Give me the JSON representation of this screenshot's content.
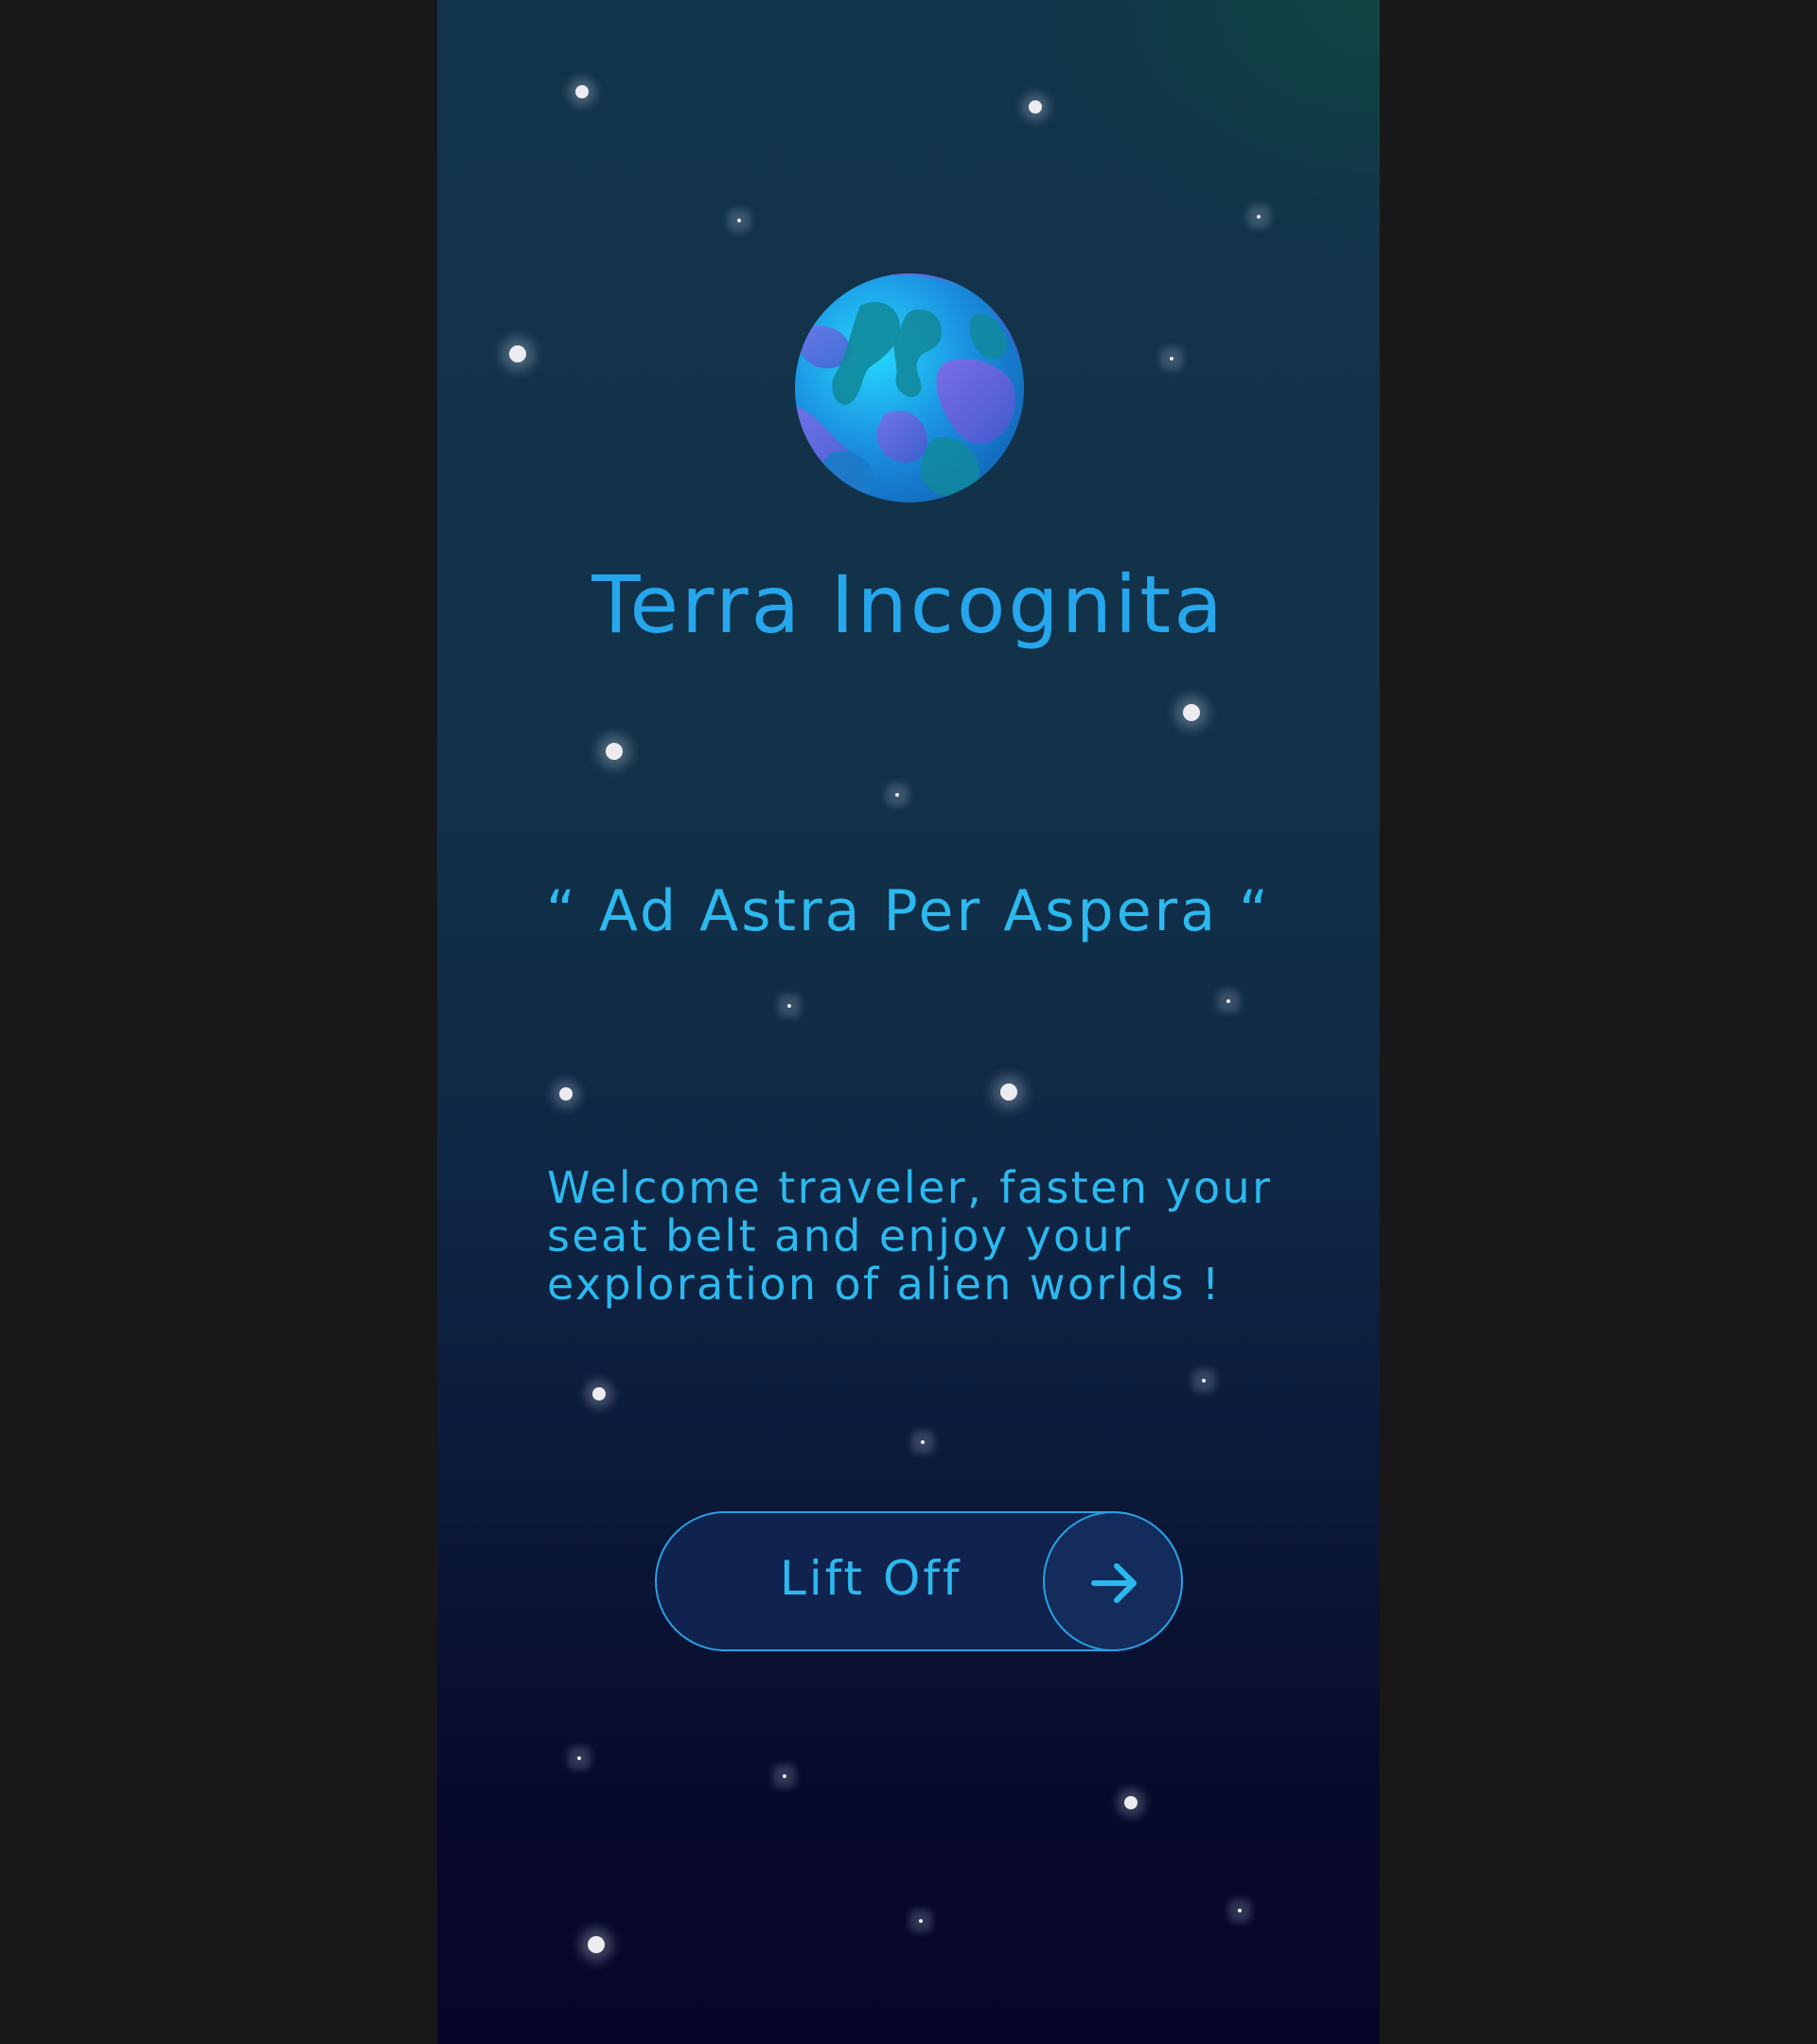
{
  "app": {
    "title": "Terra Incognita",
    "motto": "“ Ad Astra Per Aspera “",
    "welcome": "Welcome traveler, fasten your seat belt and enjoy your exploration of alien worlds !"
  },
  "cta": {
    "label": "Lift Off",
    "icon": "arrow-right-icon"
  },
  "illustration": {
    "icon": "planet-icon"
  },
  "colors": {
    "accent": "#2bb9ef",
    "background_top": "#12344b",
    "background_bottom": "#06062a",
    "star": "#ececf0"
  }
}
